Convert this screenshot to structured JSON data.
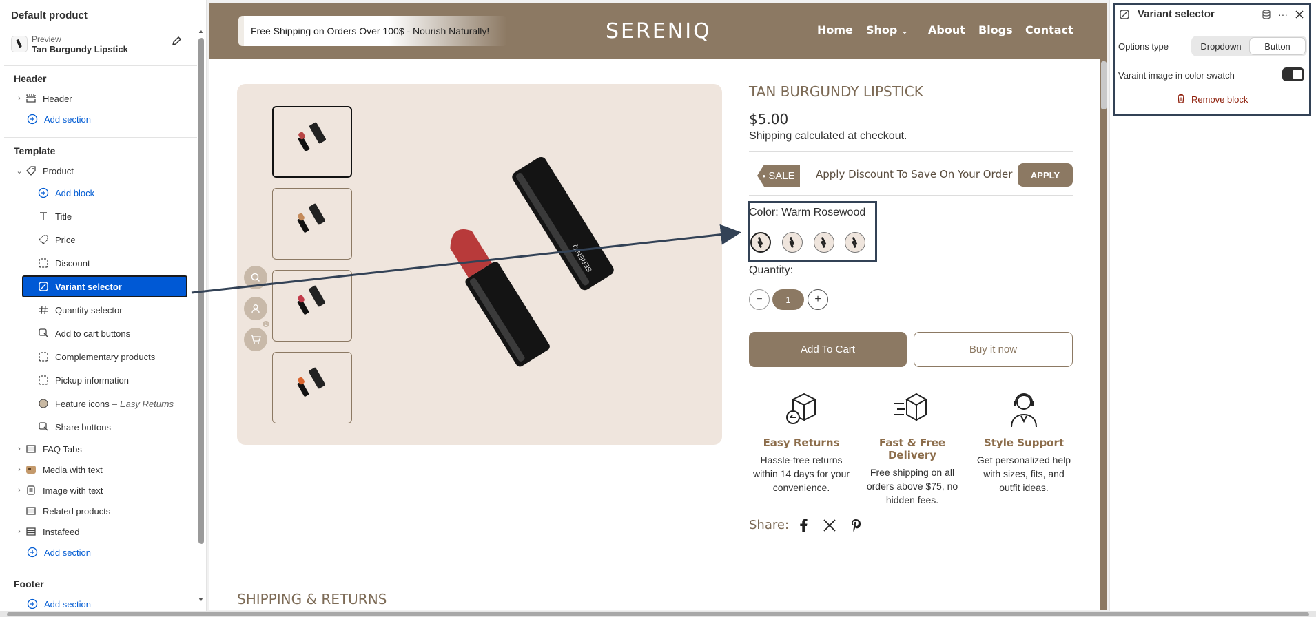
{
  "sidebar": {
    "title": "Default product",
    "preview": {
      "label": "Preview",
      "value": "Tan Burgundy Lipstick"
    },
    "header_section": {
      "heading": "Header",
      "item": "Header",
      "add": "Add section"
    },
    "template": {
      "heading": "Template",
      "product": "Product",
      "add_block": "Add block",
      "blocks": [
        "Title",
        "Price",
        "Discount",
        "Variant selector",
        "Quantity selector",
        "Add to cart buttons",
        "Complementary products",
        "Pickup information",
        "Feature icons",
        "Share buttons"
      ],
      "feature_suffix": "Easy Returns",
      "sections": [
        "FAQ Tabs",
        "Media with text",
        "Image with text",
        "Related products",
        "Instafeed"
      ],
      "add_section": "Add section"
    },
    "footer": {
      "heading": "Footer",
      "add": "Add section"
    }
  },
  "store": {
    "promo": "Free Shipping on Orders Over 100$ - Nourish Naturally!",
    "logo": "SERENIQ",
    "nav": [
      "Home",
      "Shop",
      "About",
      "Blogs",
      "Contact"
    ],
    "cart_count": "0"
  },
  "product": {
    "title": "TAN BURGUNDY LIPSTICK",
    "price": "$5.00",
    "shipping_link": "Shipping",
    "shipping_rest": " calculated at checkout.",
    "sale_tag": "SALE",
    "discount_text": "Apply Discount To Save On Your Order",
    "apply": "APPLY",
    "color_label": "Color:",
    "color_value": "Warm Rosewood",
    "quantity_label": "Quantity:",
    "quantity": "1",
    "minus": "−",
    "plus": "+",
    "add_to_cart": "Add To Cart",
    "buy_now": "Buy it now",
    "features": [
      {
        "title": "Easy Returns",
        "desc": "Hassle-free returns within 14 days for your convenience."
      },
      {
        "title": "Fast & Free Delivery",
        "desc": "Free shipping on all orders above $75, no hidden fees."
      },
      {
        "title": "Style Support",
        "desc": "Get personalized help with sizes, fits, and outfit ideas."
      }
    ],
    "share_label": "Share:",
    "next_heading": "SHIPPING & RETURNS",
    "image_brand": "SERENIQ"
  },
  "panel": {
    "title": "Variant selector",
    "options_type_label": "Options type",
    "options": [
      "Dropdown",
      "Button"
    ],
    "selected_option": "Button",
    "swatch_label": "Varaint image in color swatch",
    "swatch_on": true,
    "remove": "Remove block"
  },
  "colors": {
    "brand": "#8c7963",
    "accent": "#0059d5",
    "danger": "#8e1f0b",
    "highlight": "#334256"
  }
}
